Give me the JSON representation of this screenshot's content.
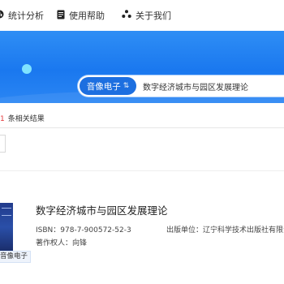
{
  "nav": {
    "stats_label": "统计分析",
    "help_label": "使用帮助",
    "about_label": "关于我们"
  },
  "search": {
    "type_label": "音像电子",
    "type_arrows": "⇅",
    "value": "数字经济城市与园区发展理论"
  },
  "results": {
    "count_number": "1",
    "count_label": "条相关结果"
  },
  "item": {
    "title": "数字经济城市与园区发展理论",
    "isbn": "ISBN：978-7-900572-52-3",
    "publisher": "出版单位：辽宁科学技术出版社有限责任公司",
    "author": "著作权人：向锋",
    "cover_tag": "音像电子"
  },
  "colors": {
    "banner": "#1a78ef",
    "accent_red": "#e4393c",
    "search_type_bg": "#1d6fe0"
  }
}
